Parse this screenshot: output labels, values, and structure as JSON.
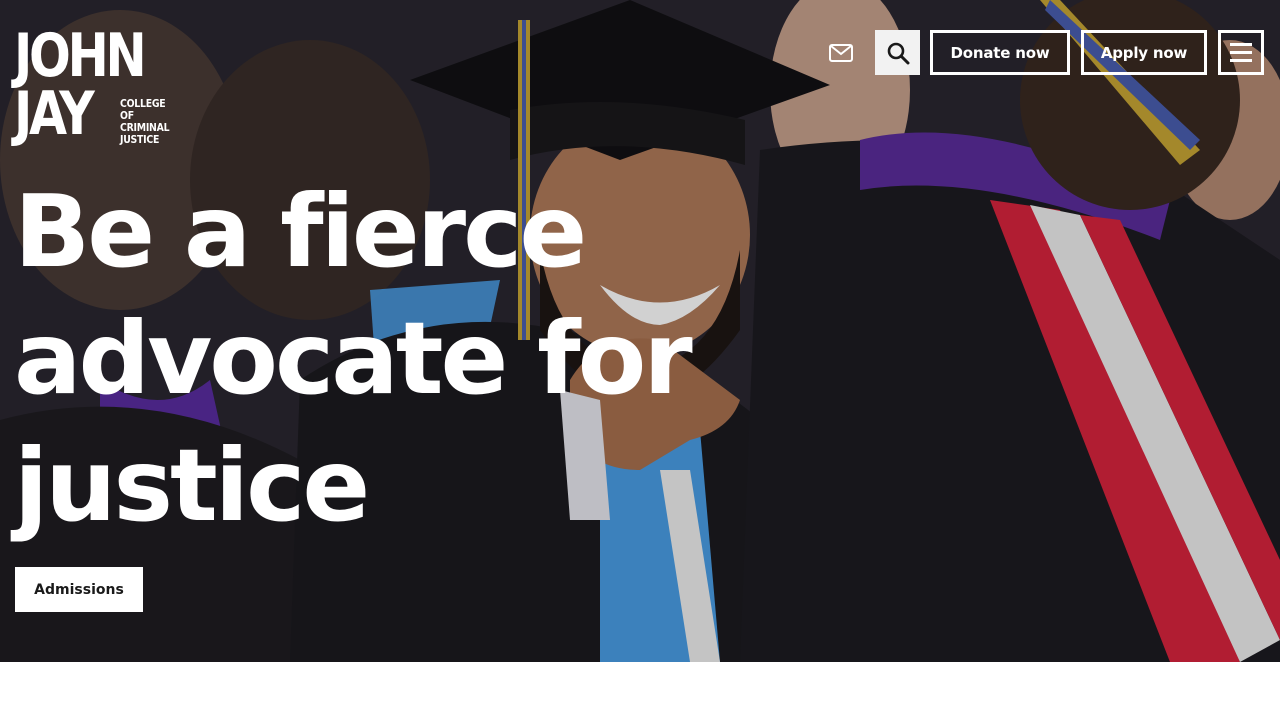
{
  "logo": {
    "line1": "JOHN",
    "line2": "JAY",
    "sub": [
      "COLLEGE",
      "OF",
      "CRIMINAL",
      "JUSTICE"
    ]
  },
  "nav": {
    "mail_icon": "mail-icon",
    "search_icon": "search-icon",
    "donate_label": "Donate now",
    "apply_label": "Apply now",
    "menu_icon": "hamburger-menu-icon"
  },
  "hero": {
    "headline_lines": [
      "Be a fierce",
      "advocate for",
      "justice"
    ],
    "cta_label": "Admissions"
  },
  "colors": {
    "text": "#ffffff",
    "search_bg": "#f2f2f2",
    "cta_bg": "#ffffff",
    "cta_text": "#1a1a1a",
    "accent_purple": "#5b2d9c",
    "accent_blue": "#4a9ee6",
    "stole_red": "#d8243e"
  }
}
